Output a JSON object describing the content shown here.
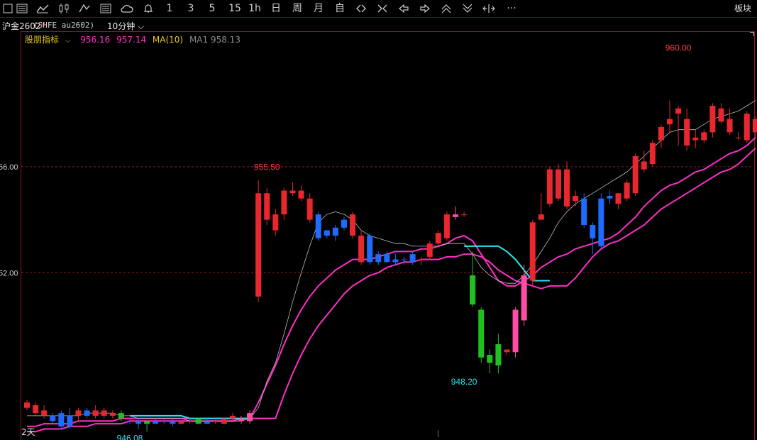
{
  "toolbar": {
    "items": [
      {
        "name": "crosshair-icon"
      },
      {
        "name": "list-icon"
      },
      {
        "name": "line-chart-icon"
      },
      {
        "name": "candle-icon"
      },
      {
        "name": "draw-tool-icon"
      },
      {
        "name": "f10-icon"
      },
      {
        "name": "cloud-icon"
      },
      {
        "name": "alert-bell-icon"
      }
    ],
    "periods": [
      "1",
      "3",
      "5",
      "15",
      "1h",
      "日",
      "周",
      "月",
      "自"
    ],
    "tools": [
      {
        "name": "zoom-in-icon"
      },
      {
        "name": "zoom-out-icon"
      },
      {
        "name": "arrow-left-icon"
      },
      {
        "name": "arrow-right-icon"
      },
      {
        "name": "arrow-up-icon"
      },
      {
        "name": "arrow-down-icon"
      },
      {
        "name": "fit-icon"
      },
      {
        "name": "more-icon"
      }
    ],
    "more_label": "···",
    "board_label": "板块"
  },
  "header": {
    "symbol": "沪金2602",
    "symbol_mark": "M",
    "code": "(SHFE au2602)",
    "period": "10分钟"
  },
  "legend": {
    "indicator": "股朋指标",
    "v1": "956.16",
    "v2": "957.14",
    "ma_label": "MA(10)",
    "ma1": "MA1 958.13"
  },
  "colors": {
    "up": "#e8272f",
    "down": "#1e6bff",
    "down_green": "#21c021",
    "pink": "#ff4da6",
    "line1": "#ff2fc8",
    "line2": "#ff2fc8",
    "cyan": "#28e6f0",
    "ma": "#bdbdbd",
    "grid": "#8b1a1a"
  },
  "chart_data": {
    "type": "candlestick",
    "ylabels": [
      "56.00",
      "52.00"
    ],
    "yticks": [
      956.0,
      952.0
    ],
    "ylim": [
      945.9,
      960.9
    ],
    "annotations": [
      {
        "text": "955.50",
        "value": 955.5,
        "bar": 28,
        "color": "#ff4040",
        "pos": "above"
      },
      {
        "text": "960.00",
        "value": 960.0,
        "bar": 76,
        "color": "#ff4040",
        "pos": "above"
      },
      {
        "text": "948.20",
        "value": 948.2,
        "bar": 51,
        "color": "#28e6f0",
        "pos": "below"
      },
      {
        "text": "946.08",
        "value": 946.08,
        "bar": 12,
        "color": "#28e6f0",
        "pos": "below"
      }
    ],
    "period_label": "2天",
    "candles": [
      [
        947.1,
        946.9,
        947.2,
        946.8,
        "up"
      ],
      [
        947.0,
        946.7,
        947.1,
        946.6,
        "up"
      ],
      [
        946.8,
        946.6,
        947.0,
        946.5,
        "up"
      ],
      [
        946.4,
        946.6,
        946.7,
        946.3,
        "down"
      ],
      [
        946.2,
        946.7,
        946.8,
        946.1,
        "down"
      ],
      [
        946.6,
        946.2,
        946.9,
        946.1,
        "down"
      ],
      [
        946.8,
        946.6,
        946.9,
        946.4,
        "up"
      ],
      [
        946.6,
        946.8,
        946.9,
        946.5,
        "down"
      ],
      [
        946.8,
        946.6,
        947.0,
        946.5,
        "up"
      ],
      [
        946.8,
        946.6,
        946.9,
        946.5,
        "up"
      ],
      [
        946.7,
        946.6,
        946.8,
        946.5,
        "up"
      ],
      [
        946.7,
        946.5,
        946.8,
        946.4,
        "down_green"
      ],
      [
        946.4,
        946.4,
        946.5,
        946.3,
        "down"
      ],
      [
        946.3,
        946.4,
        946.5,
        946.1,
        "down"
      ],
      [
        946.3,
        946.4,
        946.4,
        946.0,
        "down_green"
      ],
      [
        946.4,
        946.3,
        946.5,
        946.3,
        "down"
      ],
      [
        946.4,
        946.4,
        946.5,
        946.3,
        "down"
      ],
      [
        946.4,
        946.3,
        946.5,
        946.2,
        "down"
      ],
      [
        946.3,
        946.4,
        946.4,
        946.3,
        "up"
      ],
      [
        946.4,
        946.4,
        946.5,
        946.3,
        "up"
      ],
      [
        946.3,
        946.5,
        946.5,
        946.3,
        "down_green"
      ],
      [
        946.4,
        946.3,
        946.5,
        946.3,
        "down"
      ],
      [
        946.4,
        946.4,
        946.5,
        946.3,
        "up"
      ],
      [
        946.3,
        946.5,
        946.5,
        946.3,
        "up"
      ],
      [
        946.5,
        946.6,
        946.7,
        946.4,
        "up"
      ],
      [
        946.4,
        946.5,
        946.6,
        946.3,
        "pink"
      ],
      [
        946.4,
        946.7,
        946.8,
        946.3,
        "pink"
      ],
      [
        951.1,
        955.0,
        955.5,
        950.9,
        "up"
      ],
      [
        954.0,
        955.0,
        955.2,
        953.8,
        "up"
      ],
      [
        953.6,
        954.2,
        954.4,
        953.4,
        "up"
      ],
      [
        954.2,
        955.1,
        955.2,
        954.0,
        "up"
      ],
      [
        955.0,
        955.1,
        955.4,
        954.9,
        "up"
      ],
      [
        954.8,
        955.1,
        955.3,
        954.7,
        "up"
      ],
      [
        954.0,
        954.8,
        955.0,
        953.9,
        "up"
      ],
      [
        954.2,
        953.3,
        954.3,
        953.2,
        "down"
      ],
      [
        953.4,
        953.6,
        953.6,
        953.3,
        "down"
      ],
      [
        953.4,
        953.7,
        953.8,
        953.2,
        "down"
      ],
      [
        954.0,
        953.7,
        954.1,
        953.6,
        "down"
      ],
      [
        953.4,
        954.2,
        954.3,
        953.3,
        "up"
      ],
      [
        952.4,
        953.4,
        953.6,
        952.3,
        "up"
      ],
      [
        952.4,
        953.4,
        953.5,
        952.3,
        "down"
      ],
      [
        952.4,
        952.7,
        952.8,
        952.3,
        "down"
      ],
      [
        952.4,
        952.7,
        952.8,
        952.4,
        "down"
      ],
      [
        952.4,
        952.5,
        952.7,
        952.3,
        "down"
      ],
      [
        952.5,
        952.5,
        952.6,
        952.3,
        "down"
      ],
      [
        952.4,
        952.7,
        952.8,
        952.3,
        "down"
      ],
      [
        952.5,
        952.5,
        952.6,
        952.3,
        "up"
      ],
      [
        952.6,
        953.1,
        953.2,
        952.5,
        "up"
      ],
      [
        953.1,
        953.5,
        953.6,
        953.0,
        "up"
      ],
      [
        953.3,
        954.2,
        954.3,
        953.2,
        "up"
      ],
      [
        954.2,
        954.1,
        954.5,
        954.0,
        "pink"
      ],
      [
        954.2,
        954.2,
        954.3,
        954.1,
        "up"
      ],
      [
        951.9,
        950.8,
        952.8,
        950.7,
        "down_green"
      ],
      [
        950.6,
        948.8,
        950.7,
        948.6,
        "down_green"
      ],
      [
        948.9,
        948.6,
        949.1,
        948.2,
        "down_green"
      ],
      [
        948.5,
        949.3,
        949.7,
        948.2,
        "down_green"
      ],
      [
        949.0,
        949.1,
        949.1,
        948.9,
        "up"
      ],
      [
        949.0,
        950.6,
        950.7,
        948.8,
        "pink"
      ],
      [
        950.2,
        951.9,
        952.3,
        950.0,
        "pink"
      ],
      [
        951.7,
        953.9,
        954.0,
        951.5,
        "up"
      ],
      [
        954.0,
        954.2,
        955.0,
        954.0,
        "up"
      ],
      [
        954.6,
        955.9,
        956.0,
        954.5,
        "up"
      ],
      [
        954.8,
        955.9,
        956.1,
        954.7,
        "up"
      ],
      [
        954.5,
        955.9,
        956.2,
        954.4,
        "up"
      ],
      [
        954.7,
        954.9,
        955.1,
        954.5,
        "up"
      ],
      [
        954.8,
        953.8,
        955.0,
        953.7,
        "down"
      ],
      [
        953.3,
        953.8,
        953.9,
        952.7,
        "down"
      ],
      [
        953.0,
        954.8,
        955.0,
        952.9,
        "down"
      ],
      [
        954.8,
        954.9,
        955.1,
        954.6,
        "down"
      ],
      [
        954.6,
        955.0,
        955.0,
        954.4,
        "up"
      ],
      [
        954.8,
        955.4,
        955.5,
        954.7,
        "up"
      ],
      [
        955.0,
        956.4,
        956.5,
        954.9,
        "up"
      ],
      [
        955.9,
        956.2,
        956.6,
        955.8,
        "up"
      ],
      [
        956.1,
        956.9,
        957.0,
        956.0,
        "up"
      ],
      [
        957.0,
        957.5,
        957.6,
        956.7,
        "up"
      ],
      [
        957.6,
        957.8,
        958.5,
        957.3,
        "up"
      ],
      [
        958.2,
        958.0,
        958.3,
        956.8,
        "up"
      ],
      [
        956.8,
        957.8,
        958.2,
        956.6,
        "up"
      ],
      [
        957.1,
        957.0,
        957.4,
        956.7,
        "up"
      ],
      [
        957.0,
        957.3,
        957.4,
        956.9,
        "up"
      ],
      [
        957.3,
        958.3,
        958.4,
        957.1,
        "up"
      ],
      [
        957.7,
        958.2,
        958.4,
        957.6,
        "up"
      ],
      [
        957.8,
        957.3,
        958.2,
        957.2,
        "up"
      ],
      [
        957.1,
        957.1,
        957.3,
        957.0,
        "up"
      ],
      [
        957.0,
        958.0,
        958.1,
        956.9,
        "up"
      ],
      [
        957.3,
        957.8,
        957.9,
        957.1,
        "up"
      ]
    ],
    "line_ma": [
      946.6,
      946.6,
      946.6,
      946.6,
      946.6,
      946.6,
      946.6,
      946.7,
      946.7,
      946.7,
      946.7,
      946.6,
      946.6,
      946.5,
      946.5,
      946.5,
      946.5,
      946.5,
      946.5,
      946.4,
      946.4,
      946.4,
      946.4,
      946.4,
      946.4,
      946.4,
      946.5,
      946.9,
      947.9,
      948.6,
      949.7,
      950.9,
      952.0,
      953.0,
      953.9,
      954.2,
      954.3,
      954.2,
      954.0,
      953.6,
      953.4,
      953.3,
      953.2,
      953.1,
      953.1,
      953.0,
      953.0,
      953.0,
      953.0,
      953.1,
      953.1,
      953.1,
      952.7,
      952.2,
      951.9,
      951.7,
      951.6,
      951.6,
      951.9,
      952.3,
      952.8,
      953.3,
      953.9,
      954.3,
      954.6,
      954.8,
      955.0,
      955.2,
      955.4,
      955.6,
      955.8,
      956.1,
      956.4,
      956.7,
      957.0,
      957.3,
      957.4,
      957.4,
      957.4,
      957.6,
      957.8,
      957.9,
      958.0,
      958.1,
      958.3,
      958.5
    ],
    "line_cyan": [
      null,
      null,
      null,
      null,
      null,
      null,
      null,
      null,
      null,
      null,
      null,
      null,
      946.6,
      946.6,
      946.6,
      946.6,
      946.6,
      946.6,
      946.6,
      946.5,
      946.5,
      946.5,
      946.5,
      946.5,
      946.5,
      946.5,
      946.5,
      null,
      null,
      null,
      null,
      null,
      null,
      null,
      null,
      null,
      null,
      null,
      null,
      null,
      null,
      null,
      null,
      null,
      null,
      null,
      null,
      null,
      null,
      null,
      null,
      953.0,
      953.0,
      953.0,
      953.0,
      953.0,
      952.8,
      952.5,
      952.1,
      951.7,
      951.7,
      951.7,
      null,
      null,
      null,
      null,
      null,
      null,
      null,
      null,
      null,
      null,
      null,
      null,
      null,
      null,
      null,
      null,
      null,
      null,
      null,
      null,
      null,
      null,
      null,
      null
    ],
    "line_pink1": [
      946.2,
      946.2,
      946.3,
      946.3,
      946.3,
      946.3,
      946.4,
      946.4,
      946.4,
      946.4,
      946.4,
      946.5,
      946.5,
      946.5,
      946.5,
      946.5,
      946.5,
      946.5,
      946.5,
      946.5,
      946.5,
      946.5,
      946.5,
      946.5,
      946.5,
      946.5,
      946.5,
      947.1,
      947.8,
      948.5,
      949.3,
      950.0,
      950.6,
      951.1,
      951.5,
      951.8,
      952.1,
      952.3,
      952.5,
      952.5,
      952.5,
      952.6,
      952.7,
      952.8,
      952.8,
      952.8,
      952.9,
      952.9,
      953.0,
      953.1,
      953.3,
      953.4,
      953.2,
      952.7,
      952.2,
      951.7,
      951.5,
      951.5,
      951.7,
      951.9,
      952.2,
      952.4,
      952.6,
      952.7,
      952.9,
      953.0,
      953.1,
      953.2,
      953.3,
      953.5,
      953.8,
      954.1,
      954.5,
      954.8,
      955.1,
      955.3,
      955.4,
      955.6,
      955.8,
      955.9,
      956.1,
      956.3,
      956.5,
      956.6,
      956.8,
      957.1
    ],
    "line_pink2": [
      946.0,
      946.0,
      946.1,
      946.1,
      946.1,
      946.2,
      946.2,
      946.2,
      946.3,
      946.3,
      946.3,
      946.3,
      946.4,
      946.4,
      946.4,
      946.4,
      946.4,
      946.4,
      946.4,
      946.4,
      946.4,
      946.4,
      946.4,
      946.4,
      946.4,
      946.5,
      946.5,
      946.5,
      946.5,
      946.5,
      947.4,
      948.2,
      948.9,
      949.5,
      950.0,
      950.4,
      950.8,
      951.2,
      951.5,
      951.7,
      951.9,
      952.0,
      952.2,
      952.3,
      952.4,
      952.4,
      952.5,
      952.5,
      952.5,
      952.6,
      952.6,
      952.7,
      952.7,
      952.6,
      952.4,
      952.1,
      951.9,
      951.7,
      951.6,
      951.5,
      951.4,
      951.5,
      951.5,
      951.5,
      951.8,
      952.2,
      952.6,
      952.9,
      953.1,
      953.2,
      953.4,
      953.6,
      953.8,
      954.1,
      954.4,
      954.6,
      954.8,
      955.0,
      955.2,
      955.4,
      955.6,
      955.8,
      955.9,
      956.1,
      956.4,
      956.7
    ]
  }
}
